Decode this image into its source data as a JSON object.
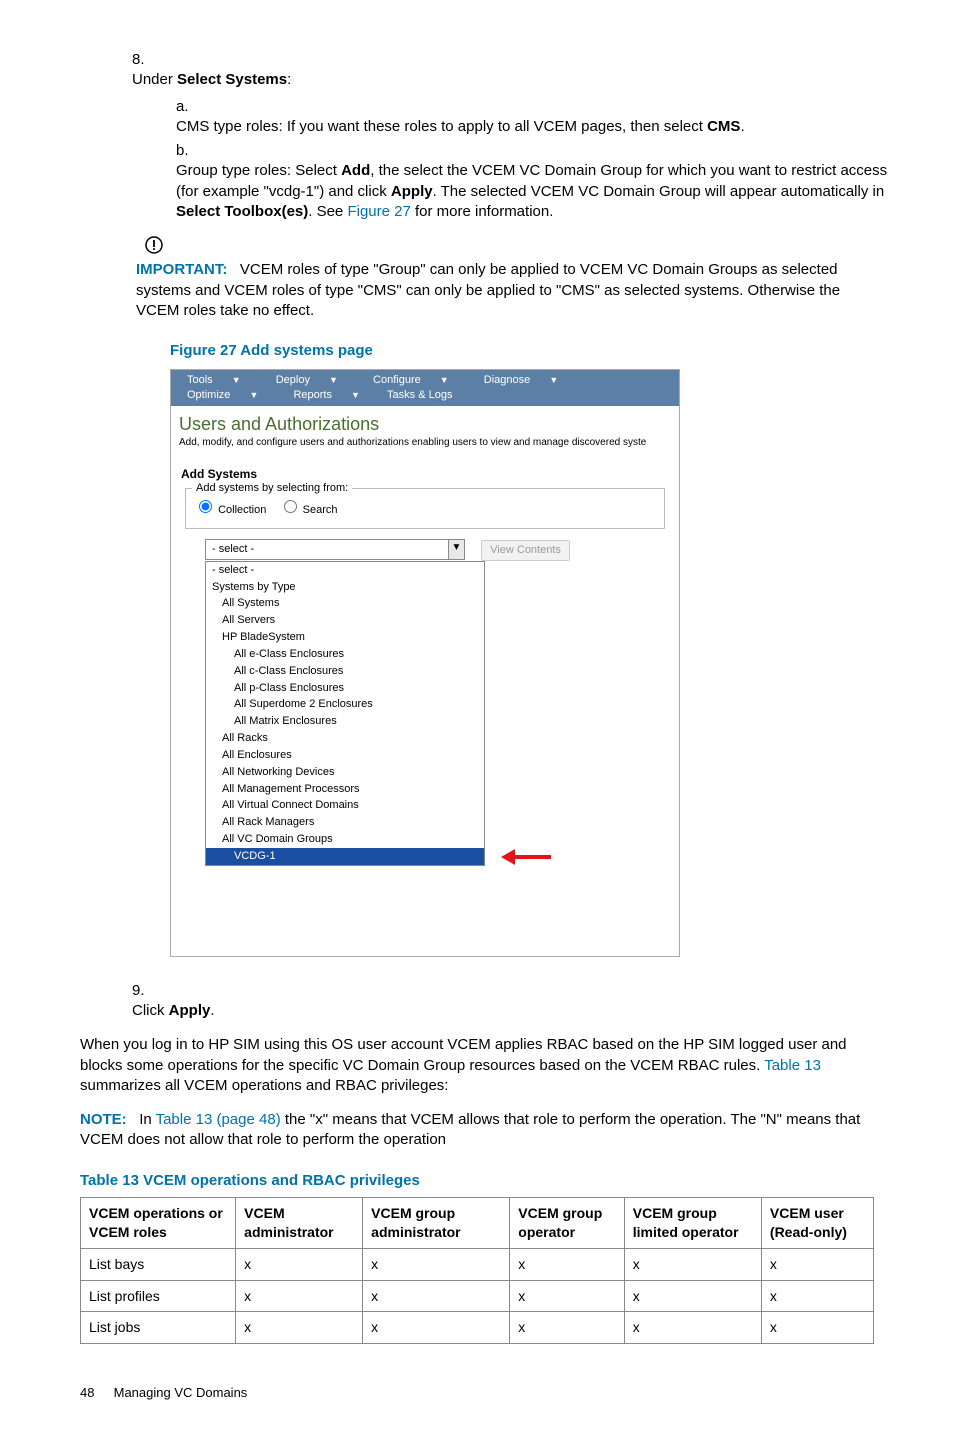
{
  "step8": {
    "num": "8.",
    "lead_pre": "Under ",
    "lead_bold": "Select Systems",
    "lead_post": ":",
    "a_letter": "a.",
    "a_text_pre": "CMS type roles: If you want these roles to apply to all VCEM pages, then select ",
    "a_text_bold": "CMS",
    "a_text_post": ".",
    "b_letter": "b.",
    "b_1": "Group type roles: Select ",
    "b_add": "Add",
    "b_2": ", the select the VCEM VC Domain Group for which you want to restrict access (for example \"vcdg-1\") and click ",
    "b_apply": "Apply",
    "b_3": ". The selected VCEM VC Domain Group will appear automatically in ",
    "b_toolbox": "Select Toolbox(es)",
    "b_4": ". See ",
    "b_link": "Figure 27",
    "b_5": " for more information."
  },
  "important": {
    "label": "IMPORTANT:",
    "text": "VCEM roles of type \"Group\" can only be applied to VCEM VC Domain Groups as selected systems and VCEM roles of type \"CMS\" can only be applied to \"CMS\" as selected systems. Otherwise the VCEM roles take no effect."
  },
  "figure": {
    "caption": "Figure 27 Add systems page",
    "menu": [
      "Tools",
      "Deploy",
      "Configure",
      "Diagnose",
      "Optimize",
      "Reports",
      "Tasks & Logs"
    ],
    "title": "Users and Authorizations",
    "subtitle": "Add, modify, and configure users and authorizations enabling users to view and manage discovered syste",
    "add_systems": "Add Systems",
    "legend": "Add systems by selecting from:",
    "r1": "Collection",
    "r2": "Search",
    "select_value": "- select -",
    "view_btn": "View Contents",
    "list": [
      {
        "t": "- select -",
        "i": 0,
        "sel": false
      },
      {
        "t": "Systems by Type",
        "i": 0,
        "sel": false
      },
      {
        "t": "All Systems",
        "i": 1,
        "sel": false
      },
      {
        "t": "All Servers",
        "i": 1,
        "sel": false
      },
      {
        "t": "HP BladeSystem",
        "i": 1,
        "sel": false
      },
      {
        "t": "All e-Class Enclosures",
        "i": 2,
        "sel": false
      },
      {
        "t": "All c-Class Enclosures",
        "i": 2,
        "sel": false
      },
      {
        "t": "All p-Class Enclosures",
        "i": 2,
        "sel": false
      },
      {
        "t": "All Superdome 2 Enclosures",
        "i": 2,
        "sel": false
      },
      {
        "t": "All Matrix Enclosures",
        "i": 2,
        "sel": false
      },
      {
        "t": "All Racks",
        "i": 1,
        "sel": false
      },
      {
        "t": "All Enclosures",
        "i": 1,
        "sel": false
      },
      {
        "t": "All Networking Devices",
        "i": 1,
        "sel": false
      },
      {
        "t": "All Management Processors",
        "i": 1,
        "sel": false
      },
      {
        "t": "All Virtual Connect Domains",
        "i": 1,
        "sel": false
      },
      {
        "t": "All Rack Managers",
        "i": 1,
        "sel": false
      },
      {
        "t": "All VC Domain Groups",
        "i": 1,
        "sel": false
      },
      {
        "t": "VCDG-1",
        "i": 2,
        "sel": true
      }
    ]
  },
  "step9": {
    "num": "9.",
    "pre": "Click ",
    "bold": "Apply",
    "post": "."
  },
  "para1_a": "When you log in to HP SIM using this OS user account VCEM applies RBAC based on the HP SIM logged user and blocks some operations for the specific VC Domain Group resources based on the VCEM RBAC rules. ",
  "para1_link": "Table 13",
  "para1_b": " summarizes all VCEM operations and RBAC privileges:",
  "note": {
    "label": "NOTE:",
    "pre": "In ",
    "link": "Table 13 (page 48)",
    "post": " the \"x\" means that VCEM allows that role to perform the operation. The \"N\" means that VCEM does not allow that role to perform the operation"
  },
  "table": {
    "caption": "Table 13 VCEM operations and RBAC privileges",
    "headers": [
      "VCEM operations or VCEM roles",
      "VCEM administrator",
      "VCEM group administrator",
      "VCEM group operator",
      "VCEM group limited operator",
      "VCEM user (Read-only)"
    ],
    "rows": [
      [
        "List bays",
        "x",
        "x",
        "x",
        "x",
        "x"
      ],
      [
        "List profiles",
        "x",
        "x",
        "x",
        "x",
        "x"
      ],
      [
        "List jobs",
        "x",
        "x",
        "x",
        "x",
        "x"
      ]
    ]
  },
  "footer": {
    "page": "48",
    "title": "Managing VC Domains"
  }
}
